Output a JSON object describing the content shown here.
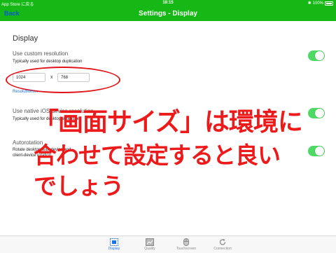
{
  "status_bar": {
    "carrier": "App Store に戻る",
    "time": "18:15",
    "battery": "100%"
  },
  "nav": {
    "back_label": "Back",
    "title": "Settings - Display"
  },
  "section": {
    "title": "Display"
  },
  "custom_resolution": {
    "label": "Use custom resolution",
    "subtitle": "Typically used for desktop duplication",
    "width": "1024",
    "separator": "x",
    "height": "768",
    "link": "Resolutions...",
    "enabled": true
  },
  "native_resolution": {
    "label": "Use native iOS device resolution",
    "subtitle": "Typically used for desktop extension",
    "enabled": true
  },
  "autorotation": {
    "label": "Autorotation",
    "subtitle_line1": "Rotate desktop with device and ",
    "subtitle_line2": "client-device rotation",
    "enabled": true
  },
  "annotation": {
    "line1": "「画面サイズ」は環境に",
    "line2": "合わせて設定すると良い",
    "line3": "でしょう"
  },
  "tabs": [
    {
      "label": "Display",
      "icon": "display-icon",
      "active": true
    },
    {
      "label": "Quality",
      "icon": "quality-icon",
      "active": false
    },
    {
      "label": "Touchscreen",
      "icon": "mouse-icon",
      "active": false
    },
    {
      "label": "Connection",
      "icon": "refresh-icon",
      "active": false
    }
  ],
  "colors": {
    "bar_green": "#15b814",
    "toggle_on": "#4cd964",
    "annotation_red": "#ec1a1a",
    "link_blue": "#1a73e8"
  }
}
